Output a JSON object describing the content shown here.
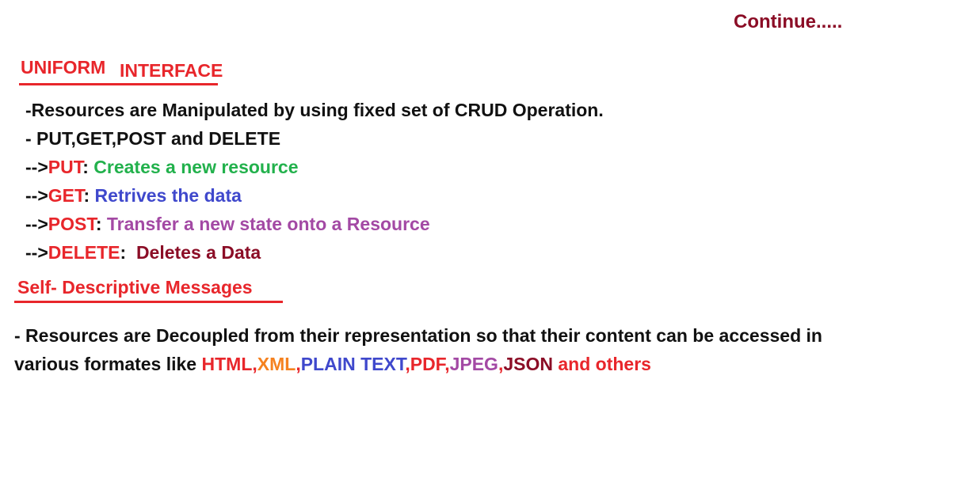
{
  "continue_text": "Continue.....",
  "uniform": {
    "title_part1": "UNIFORM",
    "title_part2": "INTERFACE",
    "line1": "-Resources are Manipulated by using fixed set of CRUD Operation.",
    "line2": "- PUT,GET,POST and DELETE",
    "items": [
      {
        "arrow": "-->",
        "method": "PUT",
        "sep": ": ",
        "desc": "Creates a new resource"
      },
      {
        "arrow": "-->",
        "method": "GET",
        "sep": ": ",
        "desc": "Retrives the data"
      },
      {
        "arrow": "-->",
        "method": "POST",
        "sep": ": ",
        "desc": "Transfer a new state onto a Resource"
      },
      {
        "arrow": "-->",
        "method": "DELETE",
        "sep": ":  ",
        "desc": "Deletes a Data"
      }
    ]
  },
  "self_descriptive": {
    "title": "Self- Descriptive Messages",
    "para_line1": "- Resources are Decoupled from their representation so that their content can be accessed in",
    "para_line2_prefix": "various formates like ",
    "formats": [
      {
        "text": "HTML",
        "color": "#e8262b"
      },
      {
        "text": ",",
        "color": "#e8262b"
      },
      {
        "text": "XML",
        "color": "#f58220"
      },
      {
        "text": ",",
        "color": "#e8262b"
      },
      {
        "text": "PLAIN TEXT",
        "color": "#3f48cc"
      },
      {
        "text": ",",
        "color": "#e8262b"
      },
      {
        "text": "PDF",
        "color": "#e8262b"
      },
      {
        "text": ",",
        "color": "#e8262b"
      },
      {
        "text": "JPEG",
        "color": "#a349a4"
      },
      {
        "text": ",",
        "color": "#e8262b"
      },
      {
        "text": "JSON",
        "color": "#8b0d26"
      },
      {
        "text": " and others",
        "color": "#e8262b"
      }
    ]
  },
  "colors": {
    "heading_red": "#e8262b",
    "method_red": "#e8262b",
    "put_desc": "#22b14c",
    "get_desc": "#3f48cc",
    "post_desc": "#a349a4",
    "delete_desc": "#8b0d26",
    "continue": "#8b0d26",
    "body_text": "#111111"
  }
}
